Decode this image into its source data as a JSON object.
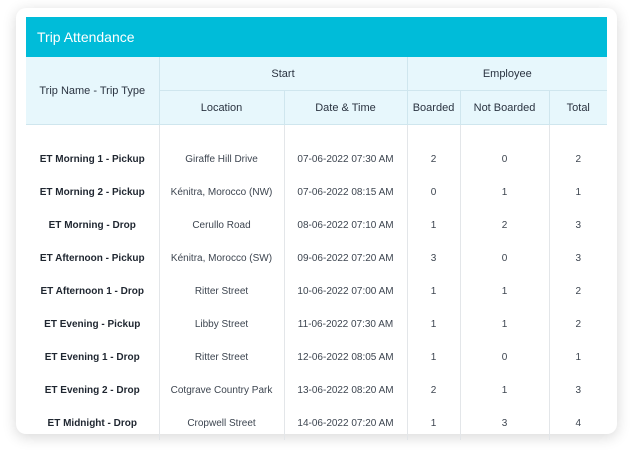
{
  "title": "Trip Attendance",
  "headers": {
    "trip_name": "Trip Name - Trip Type",
    "start_group": "Start",
    "employee_group": "Employee",
    "location": "Location",
    "date_time": "Date & Time",
    "boarded": "Boarded",
    "not_boarded": "Not Boarded",
    "total": "Total"
  },
  "rows": [
    {
      "trip": "ET Morning 1 - Pickup",
      "location": "Giraffe Hill Drive",
      "datetime": "07-06-2022 07:30 AM",
      "boarded": "2",
      "not_boarded": "0",
      "total": "2"
    },
    {
      "trip": "ET Morning 2 - Pickup",
      "location": "Kénitra, Morocco (NW)",
      "datetime": "07-06-2022 08:15 AM",
      "boarded": "0",
      "not_boarded": "1",
      "total": "1"
    },
    {
      "trip": "ET Morning - Drop",
      "location": "Cerullo Road",
      "datetime": "08-06-2022 07:10 AM",
      "boarded": "1",
      "not_boarded": "2",
      "total": "3"
    },
    {
      "trip": "ET Afternoon - Pickup",
      "location": "Kénitra, Morocco (SW)",
      "datetime": "09-06-2022 07:20 AM",
      "boarded": "3",
      "not_boarded": "0",
      "total": "3"
    },
    {
      "trip": "ET Afternoon 1 - Drop",
      "location": "Ritter Street",
      "datetime": "10-06-2022 07:00 AM",
      "boarded": "1",
      "not_boarded": "1",
      "total": "2"
    },
    {
      "trip": "ET Evening - Pickup",
      "location": "Libby Street",
      "datetime": "11-06-2022 07:30 AM",
      "boarded": "1",
      "not_boarded": "1",
      "total": "2"
    },
    {
      "trip": "ET Evening 1 - Drop",
      "location": "Ritter Street",
      "datetime": "12-06-2022 08:05 AM",
      "boarded": "1",
      "not_boarded": "0",
      "total": "1"
    },
    {
      "trip": "ET Evening 2 - Drop",
      "location": "Cotgrave Country Park",
      "datetime": "13-06-2022 08:20 AM",
      "boarded": "2",
      "not_boarded": "1",
      "total": "3"
    },
    {
      "trip": "ET Midnight - Drop",
      "location": "Cropwell Street",
      "datetime": "14-06-2022 07:20 AM",
      "boarded": "1",
      "not_boarded": "3",
      "total": "4"
    }
  ],
  "colors": {
    "title_bar": "#00bcd9",
    "header_bg": "#e7f7fc"
  }
}
